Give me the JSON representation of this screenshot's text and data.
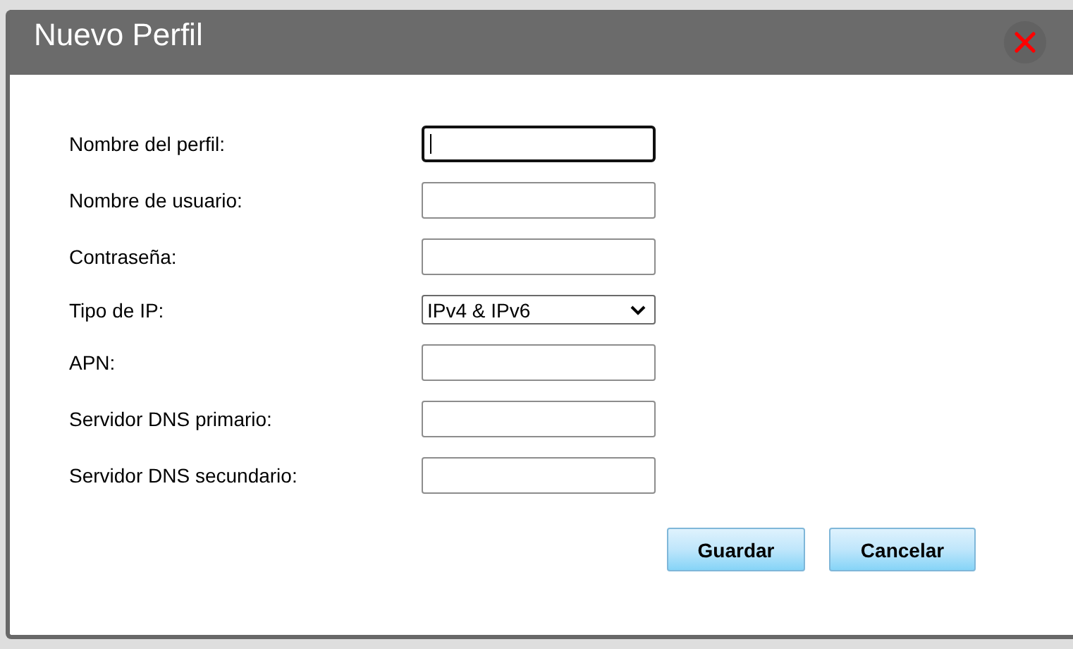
{
  "dialog": {
    "title": "Nuevo Perfil"
  },
  "fields": [
    {
      "label": "Nombre del perfil:",
      "kind": "input",
      "focused": true
    },
    {
      "label": "Nombre de usuario:",
      "kind": "input",
      "focused": false
    },
    {
      "label": "Contraseña:",
      "kind": "input",
      "focused": false
    },
    {
      "label": "Tipo de IP:",
      "kind": "select",
      "value": "IPv4 & IPv6",
      "focused": false
    },
    {
      "label": "APN:",
      "kind": "input",
      "focused": false
    },
    {
      "label": "Servidor DNS primario:",
      "kind": "input",
      "focused": false
    },
    {
      "label": "Servidor DNS secundario:",
      "kind": "input",
      "focused": false
    }
  ],
  "buttons": [
    {
      "label": "Guardar"
    },
    {
      "label": "Cancelar"
    }
  ]
}
